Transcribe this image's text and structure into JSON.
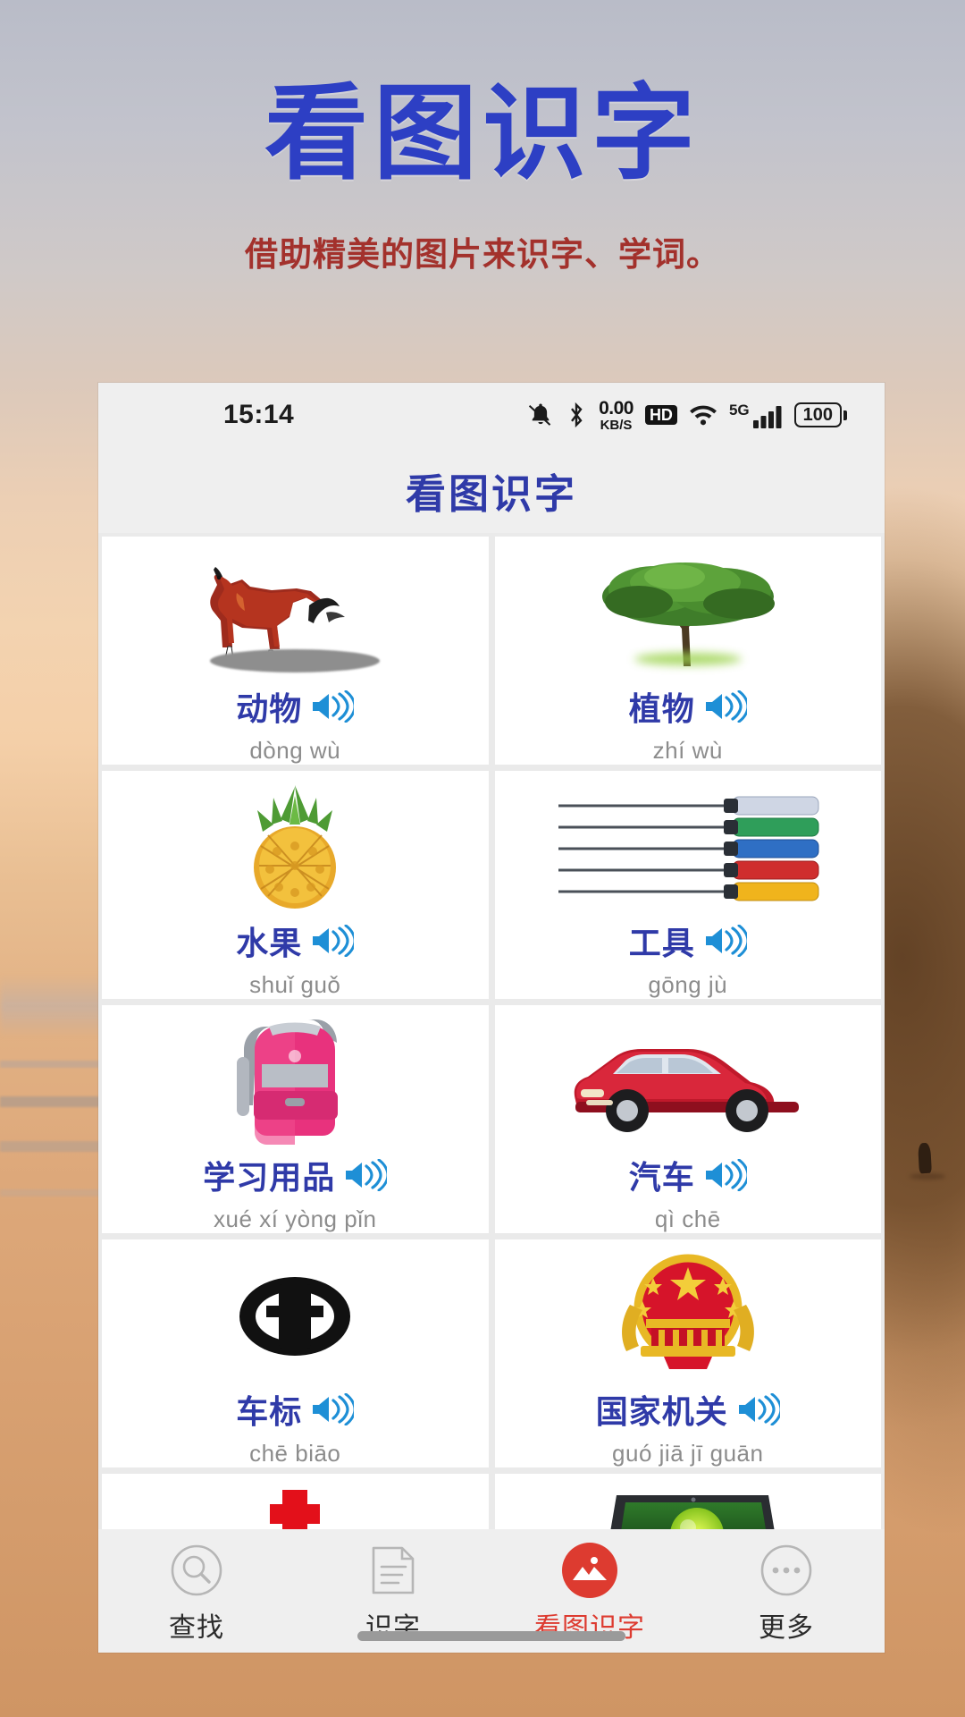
{
  "promo": {
    "title": "看图识字",
    "subtitle": "借助精美的图片来识字、学词。",
    "title_color": "#2d3fc4",
    "subtitle_color": "#a3312c"
  },
  "statusbar": {
    "time": "15:14",
    "icons": [
      "bell-muted-icon",
      "bluetooth-icon",
      "network-speed",
      "hd-badge",
      "wifi-icon",
      "signal-5g-icon",
      "battery-icon"
    ],
    "net_speed_value": "0.00",
    "net_speed_unit": "KB/S",
    "hd_label": "HD",
    "network_label": "5G",
    "battery_level": "100"
  },
  "appbar": {
    "title": "看图识字",
    "title_color": "#2f3aa8"
  },
  "grid": {
    "cards": [
      {
        "hanzi": "动物",
        "pinyin": "dòng wù",
        "art": "horse-image",
        "speaker": "speaker-icon"
      },
      {
        "hanzi": "植物",
        "pinyin": "zhí wù",
        "art": "tree-image",
        "speaker": "speaker-icon"
      },
      {
        "hanzi": "水果",
        "pinyin": "shuǐ guǒ",
        "art": "pineapple-image",
        "speaker": "speaker-icon"
      },
      {
        "hanzi": "工具",
        "pinyin": "gōng jù",
        "art": "screwdrivers-image",
        "speaker": "speaker-icon"
      },
      {
        "hanzi": "学习用品",
        "pinyin": "xué xí yòng pǐn",
        "art": "backpack-image",
        "speaker": "speaker-icon"
      },
      {
        "hanzi": "汽车",
        "pinyin": "qì chē",
        "art": "red-car-image",
        "speaker": "speaker-icon"
      },
      {
        "hanzi": "车标",
        "pinyin": "chē biāo",
        "art": "car-logo-image",
        "speaker": "speaker-icon"
      },
      {
        "hanzi": "国家机关",
        "pinyin": "guó jiā jī guān",
        "art": "national-emblem-image",
        "speaker": "speaker-icon"
      },
      {
        "hanzi": "",
        "pinyin": "",
        "art": "red-bank-logo-image",
        "speaker": "speaker-icon"
      },
      {
        "hanzi": "",
        "pinyin": "",
        "art": "laptop-image",
        "speaker": "speaker-icon"
      }
    ]
  },
  "bottomnav": {
    "items": [
      {
        "label": "查找",
        "icon": "search-icon",
        "active": false
      },
      {
        "label": "识字",
        "icon": "document-icon",
        "active": false
      },
      {
        "label": "看图识字",
        "icon": "picture-mountain-icon",
        "active": true
      },
      {
        "label": "更多",
        "icon": "more-dots-icon",
        "active": false
      }
    ],
    "active_color": "#dd3b30"
  }
}
